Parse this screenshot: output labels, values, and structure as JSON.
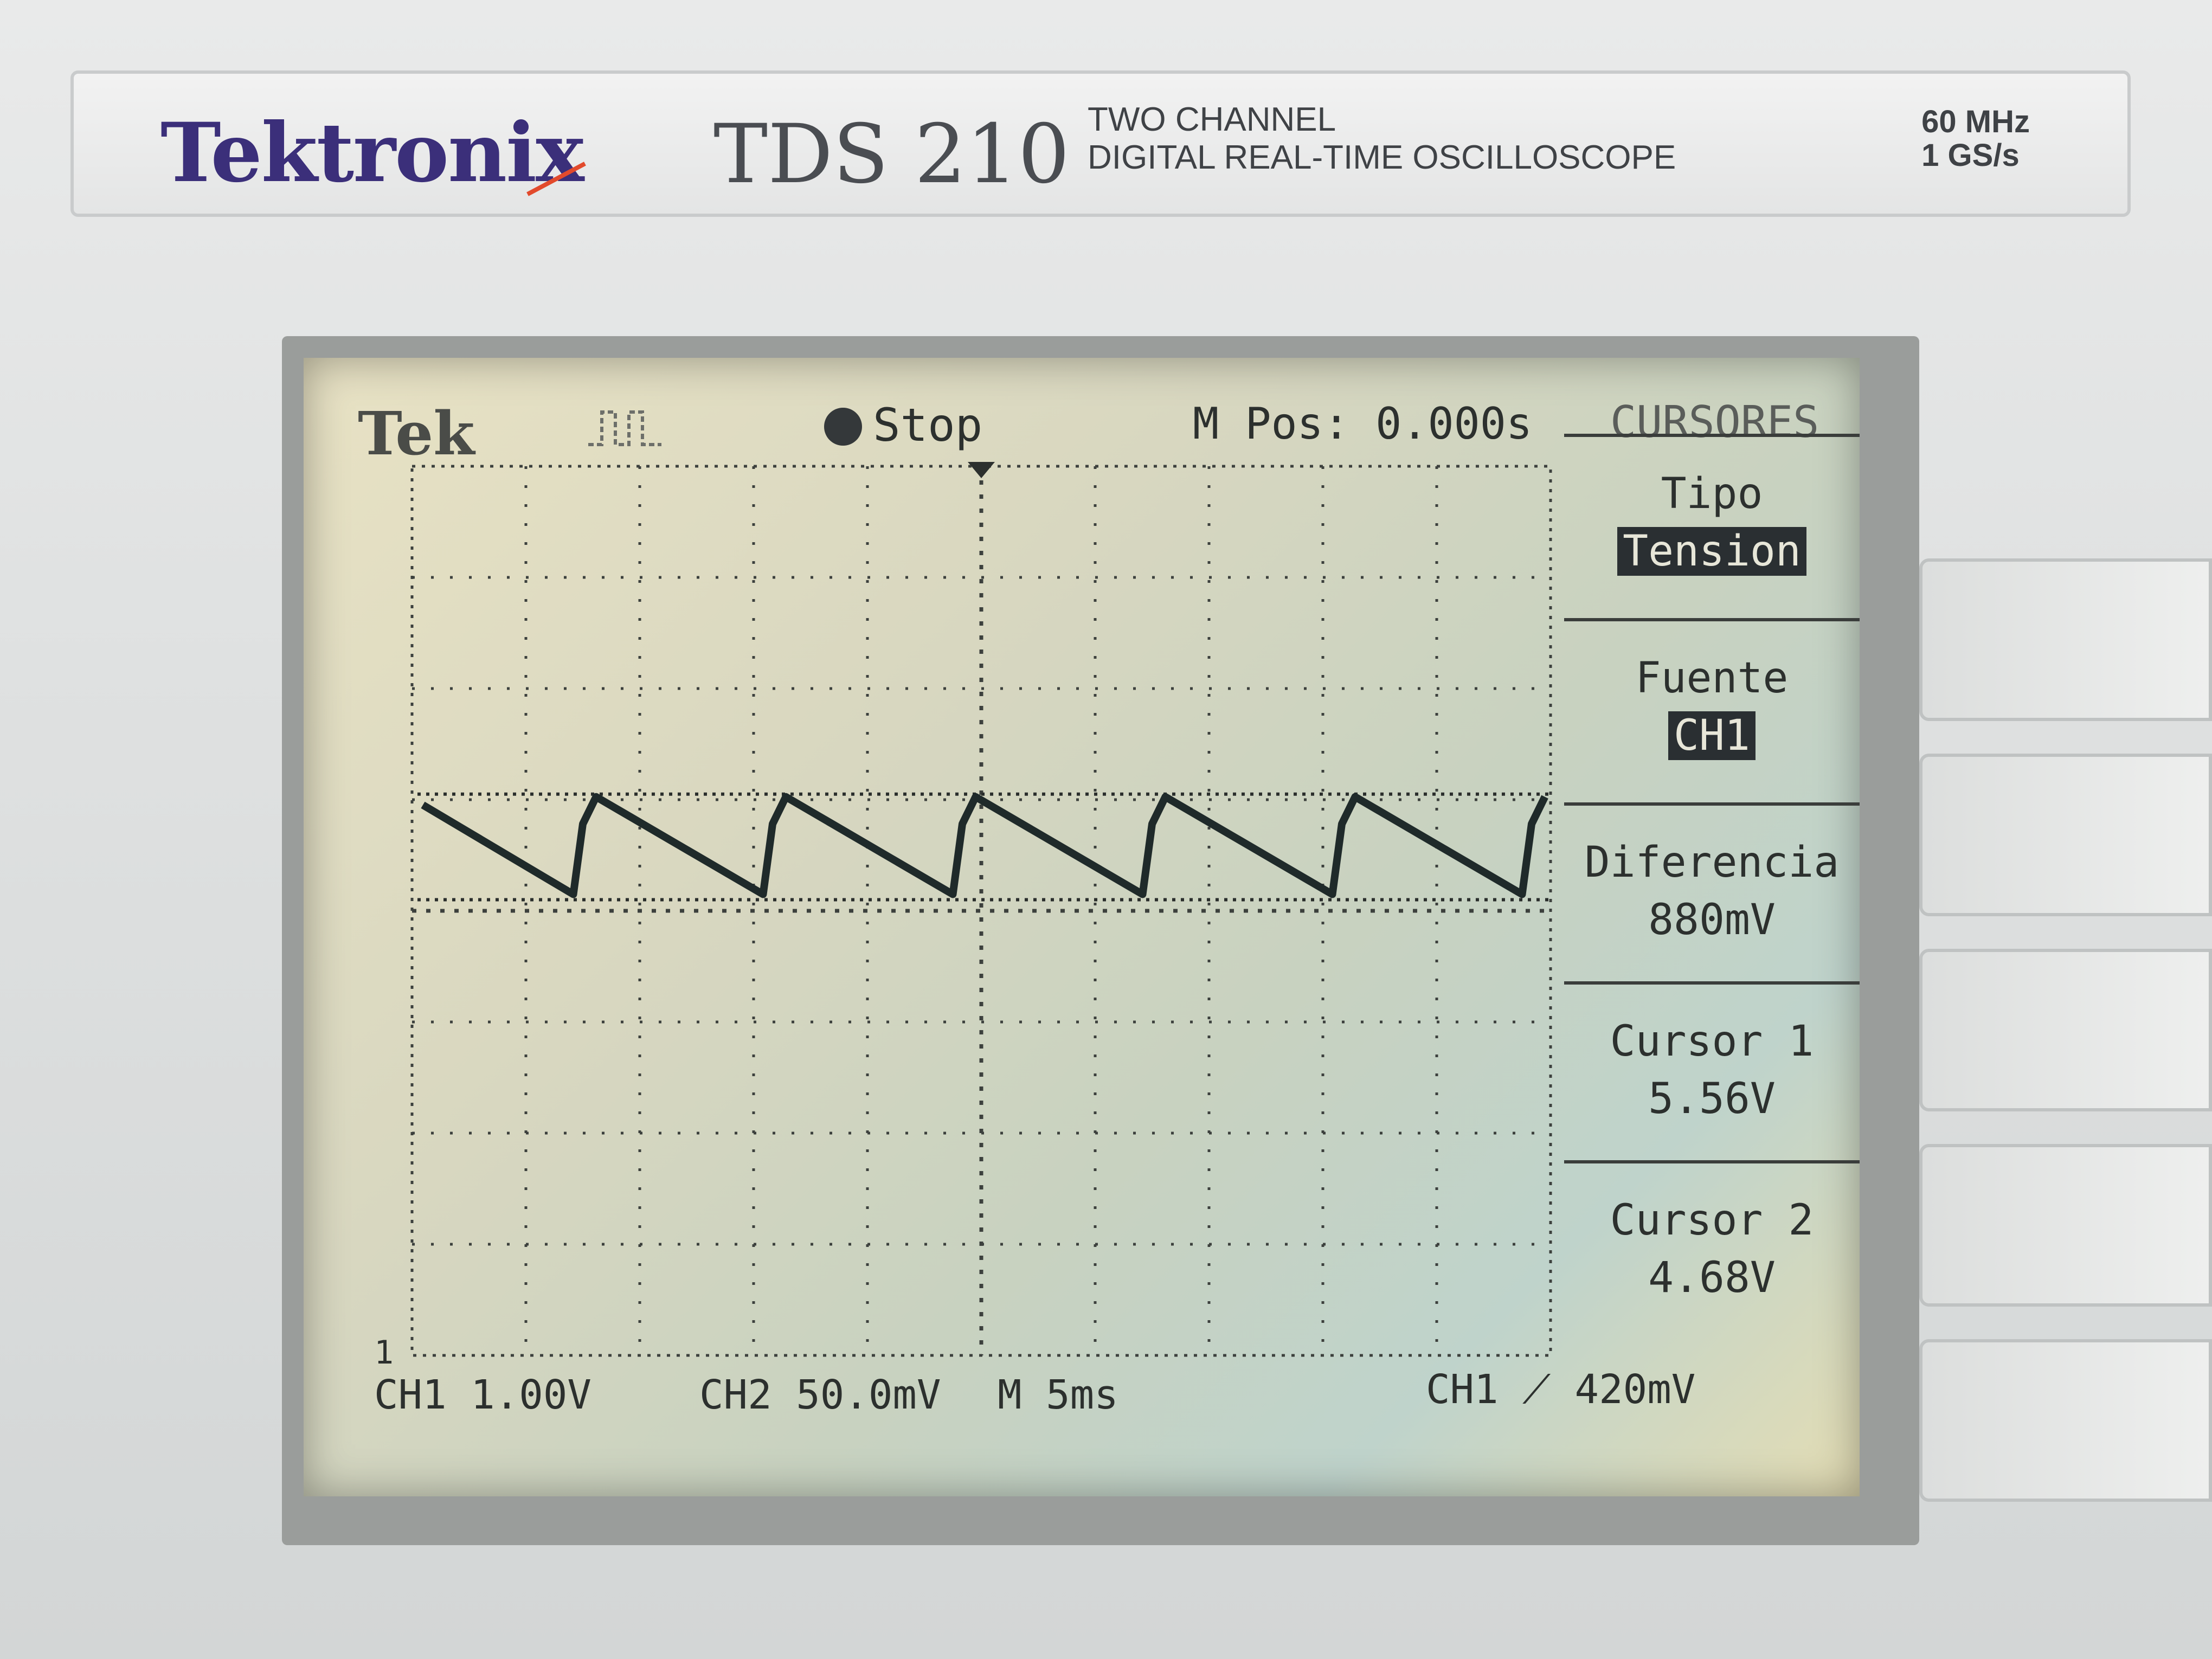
{
  "brand": {
    "logo": "Tektronix",
    "model": "TDS 210",
    "description_line1": "TWO CHANNEL",
    "description_line2": "DIGITAL REAL-TIME OSCILLOSCOPE",
    "bandwidth": "60 MHz",
    "sample_rate": "1 GS/s"
  },
  "screen": {
    "logo": "Tek",
    "status": "Stop",
    "position": "M Pos: 0.000s",
    "menu_title": "CURSORES",
    "ground_marker": "1",
    "footer": {
      "ch1_scale": "CH1 1.00V",
      "ch2_scale": "CH2 50.0mV",
      "time_scale": "M 5ms",
      "trigger": "CH1 ⟋ 420mV"
    },
    "menu": [
      {
        "label": "Tipo",
        "value": "Tension",
        "highlight": true
      },
      {
        "label": "Fuente",
        "value": "CH1",
        "highlight": true
      },
      {
        "label": "Diferencia",
        "value": "880mV",
        "highlight": false
      },
      {
        "label": "Cursor 1",
        "value": "5.56V",
        "highlight": false
      },
      {
        "label": "Cursor 2",
        "value": "4.68V",
        "highlight": false
      }
    ],
    "trace_color": "#1f2a2a",
    "waveform": {
      "type": "sawtooth ripple",
      "cycles_visible": 6,
      "peak_volts": 5.56,
      "trough_volts": 4.68
    }
  }
}
